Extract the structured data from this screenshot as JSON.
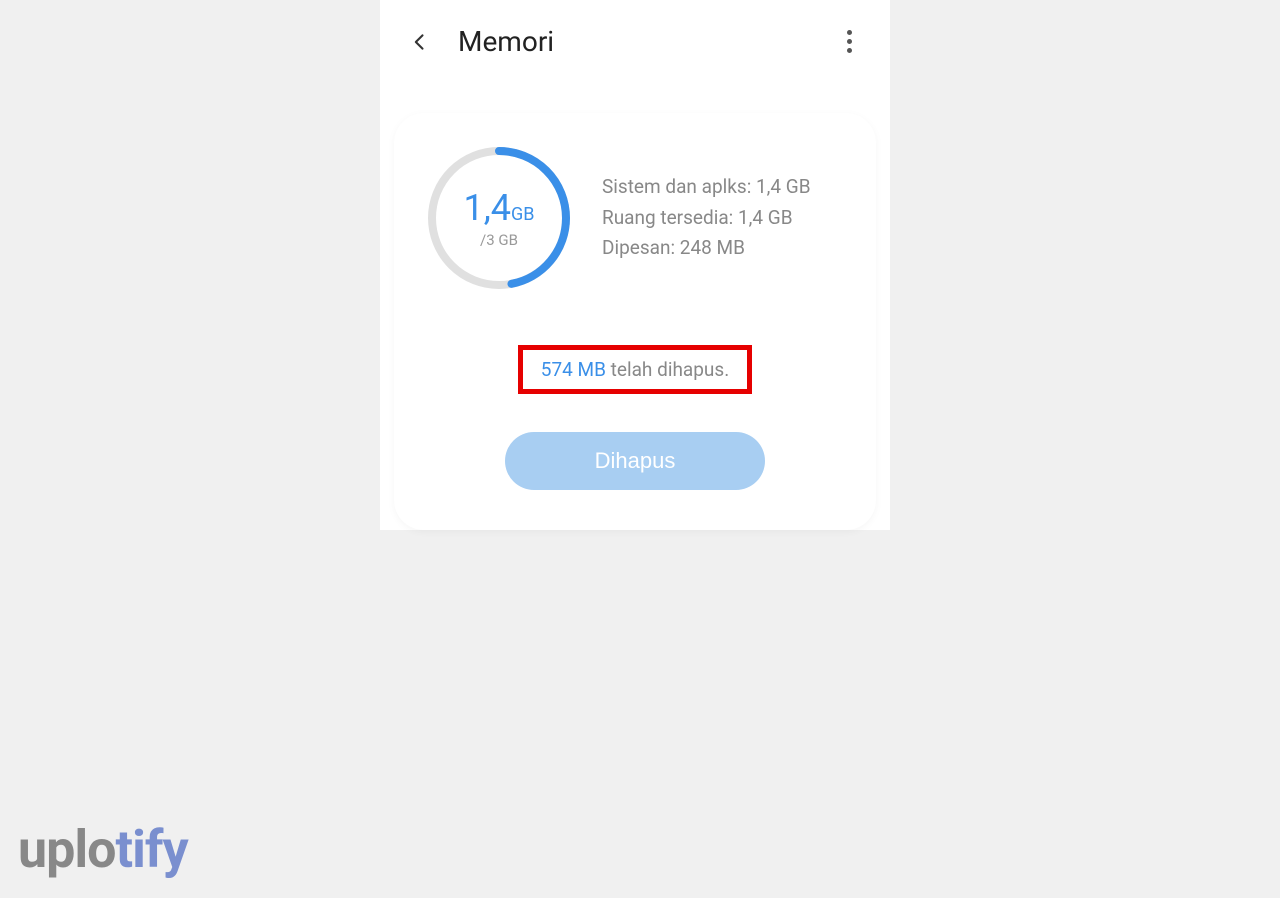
{
  "header": {
    "title": "Memori"
  },
  "ring": {
    "value": "1,4",
    "unit": "GB",
    "total": "/3 GB",
    "percent": 47
  },
  "stats": {
    "system": "Sistem dan aplks: 1,4 GB",
    "available": "Ruang tersedia: 1,4 GB",
    "reserved": "Dipesan: 248 MB"
  },
  "status": {
    "amount": "574 MB",
    "text": " telah dihapus."
  },
  "button": {
    "label": "Dihapus"
  },
  "watermark": {
    "part1": "uplo",
    "part2": "tify"
  }
}
